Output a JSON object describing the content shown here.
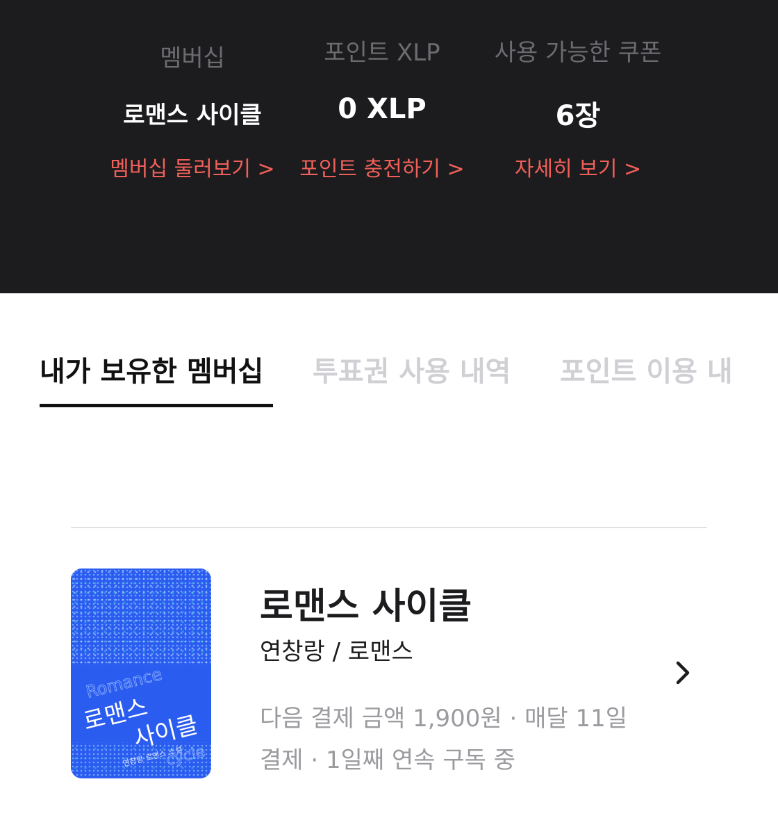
{
  "header": {
    "stats": [
      {
        "label": "멤버십",
        "value": "로맨스 사이클",
        "link": "멤버십 둘러보기 >"
      },
      {
        "label": "포인트 XLP",
        "value": "0 XLP",
        "link": "포인트 충전하기 >"
      },
      {
        "label": "사용 가능한 쿠폰",
        "value": "6장",
        "link": "자세히 보기 >"
      }
    ]
  },
  "tabs": [
    {
      "label": "내가 보유한 멤버십",
      "active": true
    },
    {
      "label": "투표권 사용 내역",
      "active": false
    },
    {
      "label": "포인트 이용 내",
      "active": false
    }
  ],
  "membership": {
    "title": "로맨스 사이클",
    "subtitle": "연창랑 / 로맨스",
    "info_line1": "다음 결제 금액 1,900원 · 매달 11일",
    "info_line2": "결제 · 1일째 연속 구독 중",
    "cover": {
      "title_line1": "로맨스",
      "title_line2": "사이클",
      "en_top": "Romance",
      "en_bottom": "cycle",
      "caption": "연창랑 로맨스 소설"
    }
  },
  "colors": {
    "header_bg": "#1c1b1d",
    "link_accent": "#f0605a",
    "cover_blue": "#2b5cf0"
  },
  "icons": {
    "chevron": "chevron-right-icon"
  }
}
